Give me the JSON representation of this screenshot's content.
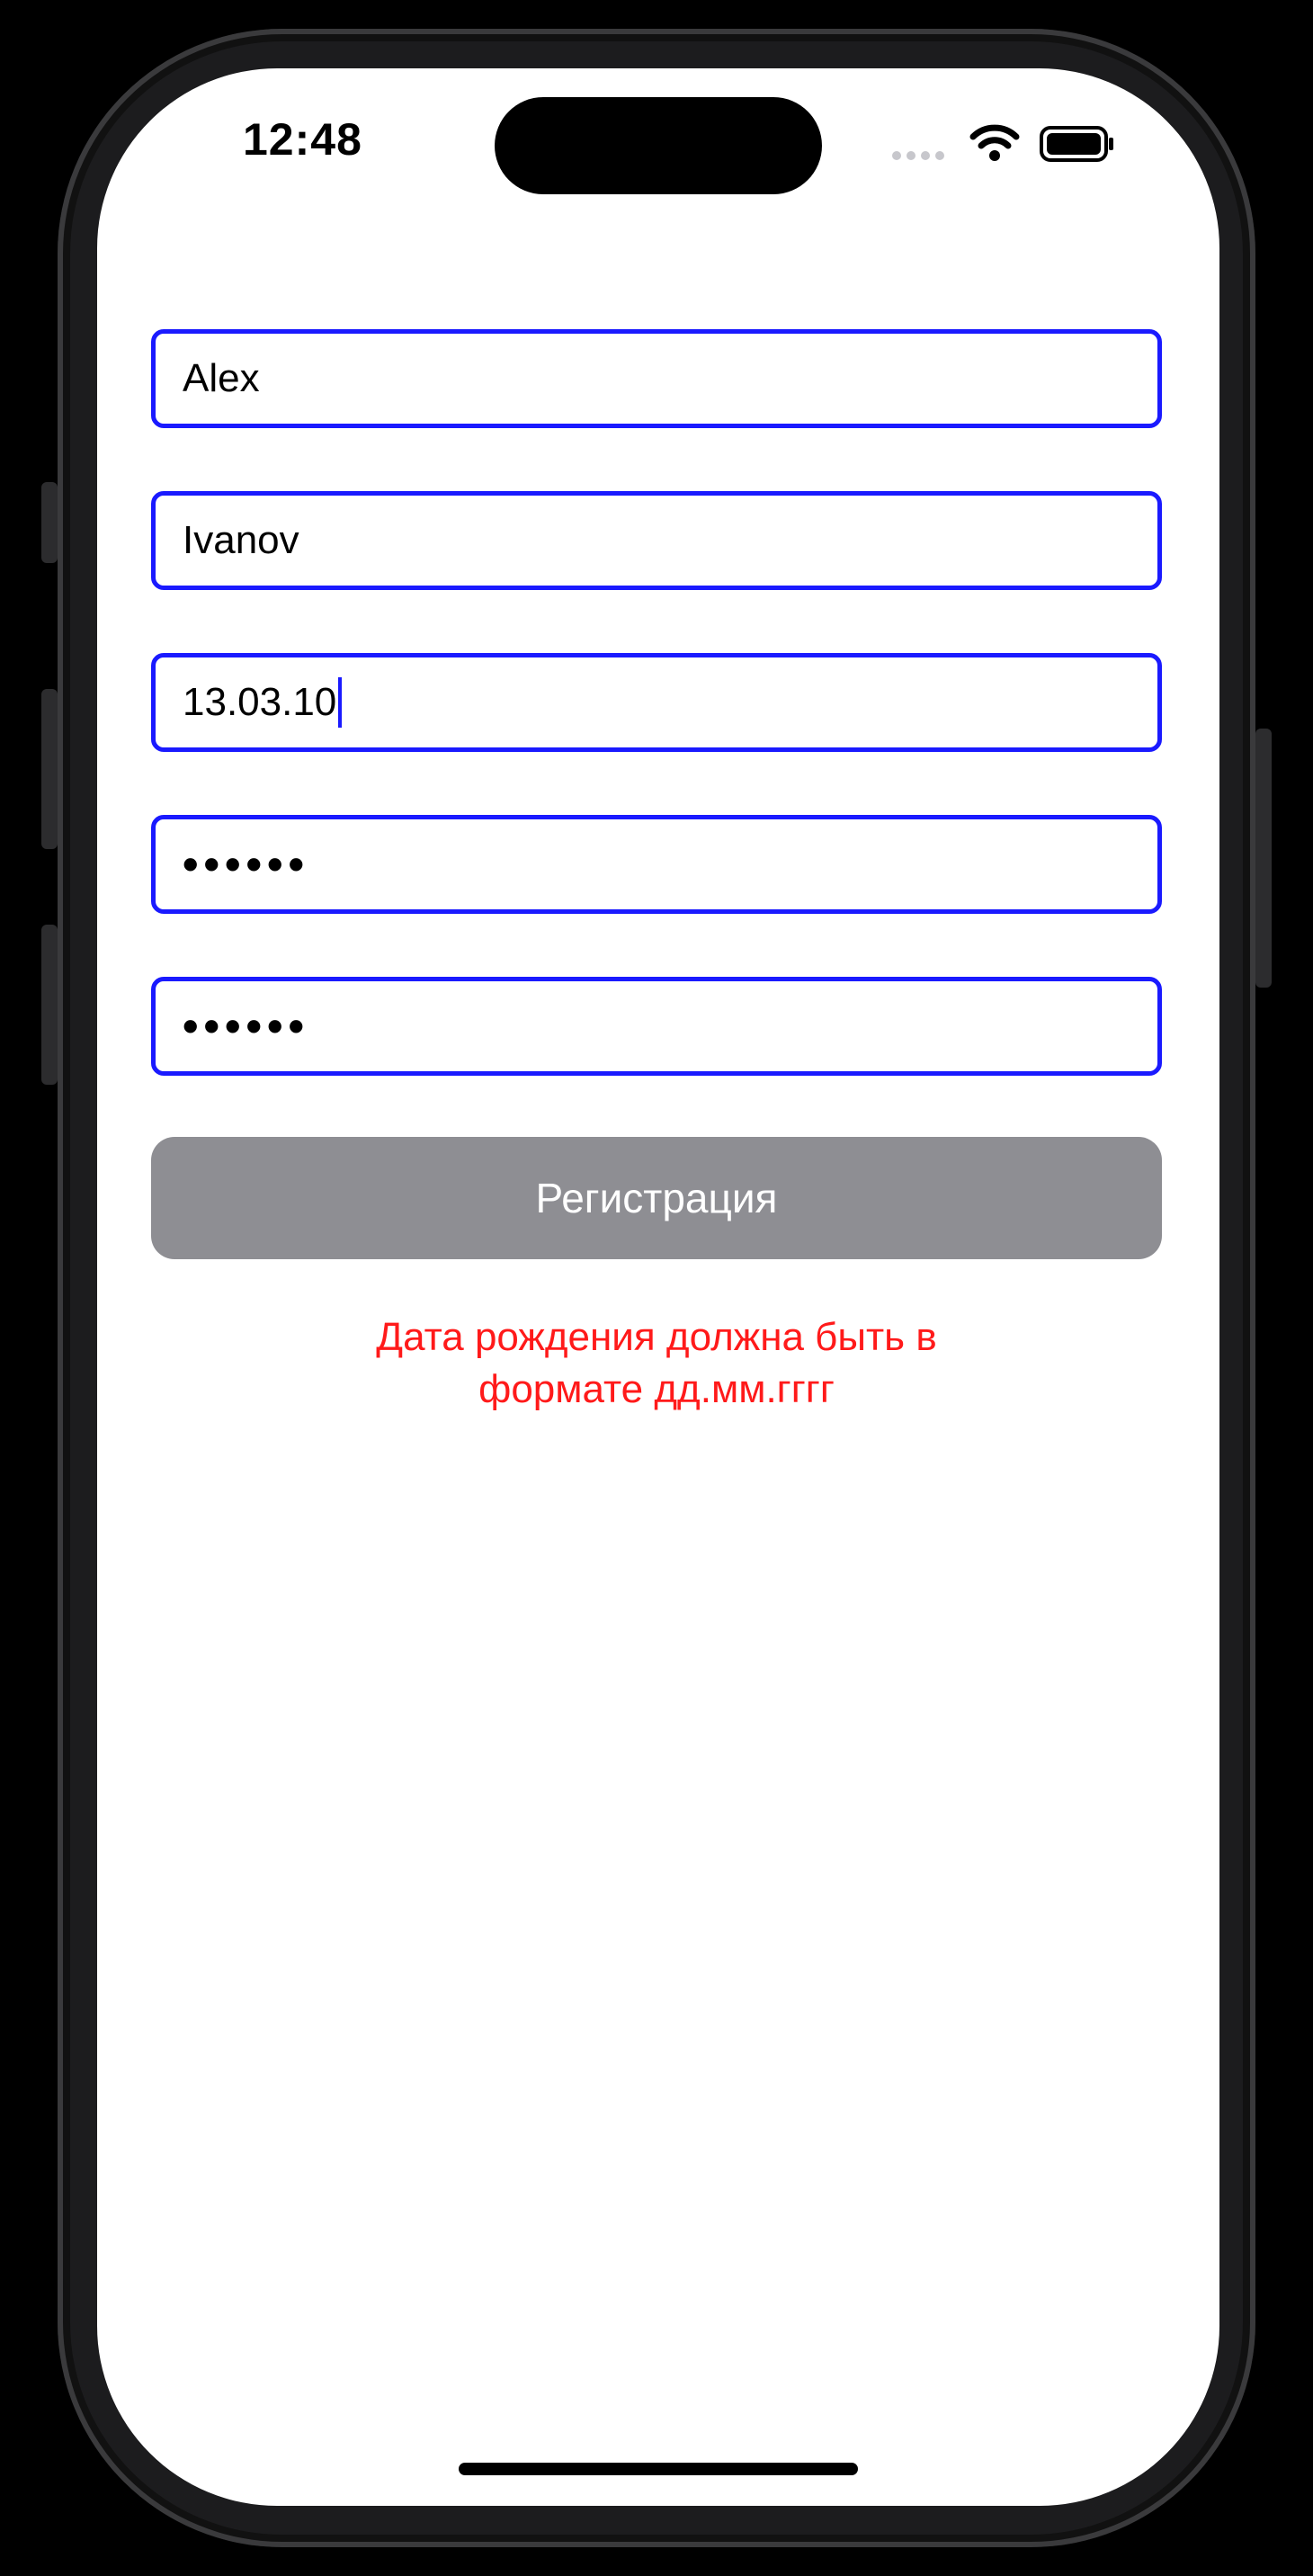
{
  "status_bar": {
    "time": "12:48"
  },
  "form": {
    "first_name": "Alex",
    "last_name": "Ivanov",
    "birth_date": "13.03.10",
    "password": "••••••",
    "password_confirm": "••••••"
  },
  "register_button": {
    "label": "Регистрация"
  },
  "error": {
    "line1": "Дата рождения должна быть в",
    "line2": "формате дд.мм.гггг"
  },
  "colors": {
    "field_border": "#1a1aff",
    "button_disabled": "#8e8e93",
    "error_text": "#ff1a1a"
  },
  "icons": [
    "signal-icon",
    "wifi-icon",
    "battery-icon"
  ]
}
